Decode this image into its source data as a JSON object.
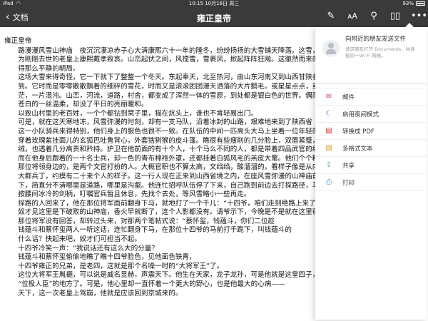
{
  "statusbar": {
    "device": "iPad",
    "time": "10:15",
    "date": "10月16日 周三",
    "battery": "93%"
  },
  "navbar": {
    "back_label": "文档",
    "title": "雍正皇帝"
  },
  "document": {
    "heading": "雍正皇帝",
    "lines": [
      "路漫漫风雪山神庙　夜沉沉凄凉赤子心大清康熙六十一年的隆冬，纷纷扬扬的大雪铺天降落。这雪，",
      "为刚刚去世的老皇上康熙戴孝致哀。山峦起伏之间，风搅雪，雪裹风，掀起阵阵狂飚。这徹然而来的暴风",
      "得那么平静的朝局。",
      "这场大雪来得奇怪，它一下就下了整整一个冬天。东起奉天，北至热河，由山东河南又到山西甘陕各",
      "到。它时而是零零散散飘着的细碎的雪花，时而又是滚滚团团漫天洒落的大片鹅毛。或星星点点，或铺天",
      "茫，一片混沌。山峦，河流，道路，村舍，都变成了浑然一体的雪原，到处都是银白色的世界。偶而也会",
      "苍白的一丝温柔，却没了平日的亮丽暖和。",
      "以致山村里的老百姓，一个个都钻到窝子里，猫在炕头上，谁也不肯轻易出门。",
      "可是，就在这天寒地冻，风雪弥漫的时刻，却有一支马队，沿着冰封的山路，艰难地来到了陕西省",
      "这一小队骑兵来得特别，他们身上的服色也很不一致。在队伍的中间一匹高头大马上坐着一位年轻的",
      "穿着玫瑰紫挂面儿的玄狐巴吐鲁背心，外套猞猁猴的皮斗篷。瞧很有些瘦削的几分脸上，双眉紧蹙，小胡",
      "绒，也透着几分高贵和矜持。护卫在他前面的有十个人，十个马么不同的人，都是带着四品武官的红缨",
      "而在他身后跟着的一十名士兵，却一色的青布棉袍外罩，还都挂着白狐风毛的羔皮大氅。他们个个精气",
      "那位将领身边的，是两个文官打扮的人。大概官职也不算太高，文绉绉，酸溜溜的，看样子像是从内务府",
      "大群兵丁，约摸有二十来个人的样子。这一行人现在正来到山西省境之内，在座风雪弥漫的山神庙前，",
      "下，简直分不清哪里是道路，哪里是沟壑。他连忙招呼队伍停了下来，自己跑到前边去打探路径，马上坐着的",
      "按腰间冰冷的剑柄，叮嘱官兵暂且休息，先找个去处，等风雪略小一些再走。",
      "探路的人回来了，他在那位将军面前翻身下马，就地打了一个千儿：“十四爷，咱们走到绝路上来了，",
      "奴才见这里是下破败的山神庙，香火早就断了，连个人影都没有。请爷示下，今晚是不是就在这里宿营",
      "那位将军没有回答，却转过头来，对那两个笔帖式说：“蔡怀玺，钱蕴斗，你们二位趁",
      "钱蕴斗和蔡怀玺两人一听这话，连忙翻身下马，在那位十四爷的马前打千跪下，叫钱蕴斗的",
      "什么话？快起来吧，奴才们可担当不起。",
      "十四爷冷笑一声：“我说话还有这么大的分量？",
      "钱蕴斗和蔡怀玺偷偷地瞧了瞧十四爷脸色，见他面色铁青，",
      "十四爷雍正的兄弟，是老四，这就是那个名噪一时的“大将军王”了。",
      "这位大将军王胤禵，可以说是威名显赫，声震天下。他生在天家，龙子龙孙，可是他就是这皇四子，",
      "“位极人臣”的地方了。可是，他心里却一直怀着一个更大的野心，也是他最大的心病——",
      "天下，这一次老皇上驾崩，他就是应该回到京城来的。"
    ]
  },
  "share_menu": {
    "recent_title": "向附近的朋友发送文件",
    "recent_sub": "请求朋友打开 Documents，并连接同一Wi-Fi 网络。",
    "items": [
      {
        "label": "邮件",
        "icon": "mail-icon"
      },
      {
        "label": "启用夜间模式",
        "icon": "moon-icon"
      },
      {
        "label": "转换成 PDF",
        "icon": "pdf-icon"
      },
      {
        "label": "多格式文本",
        "icon": "document-icon"
      },
      {
        "label": "共享",
        "icon": "share-icon"
      },
      {
        "label": "打印",
        "icon": "printer-icon"
      }
    ]
  }
}
